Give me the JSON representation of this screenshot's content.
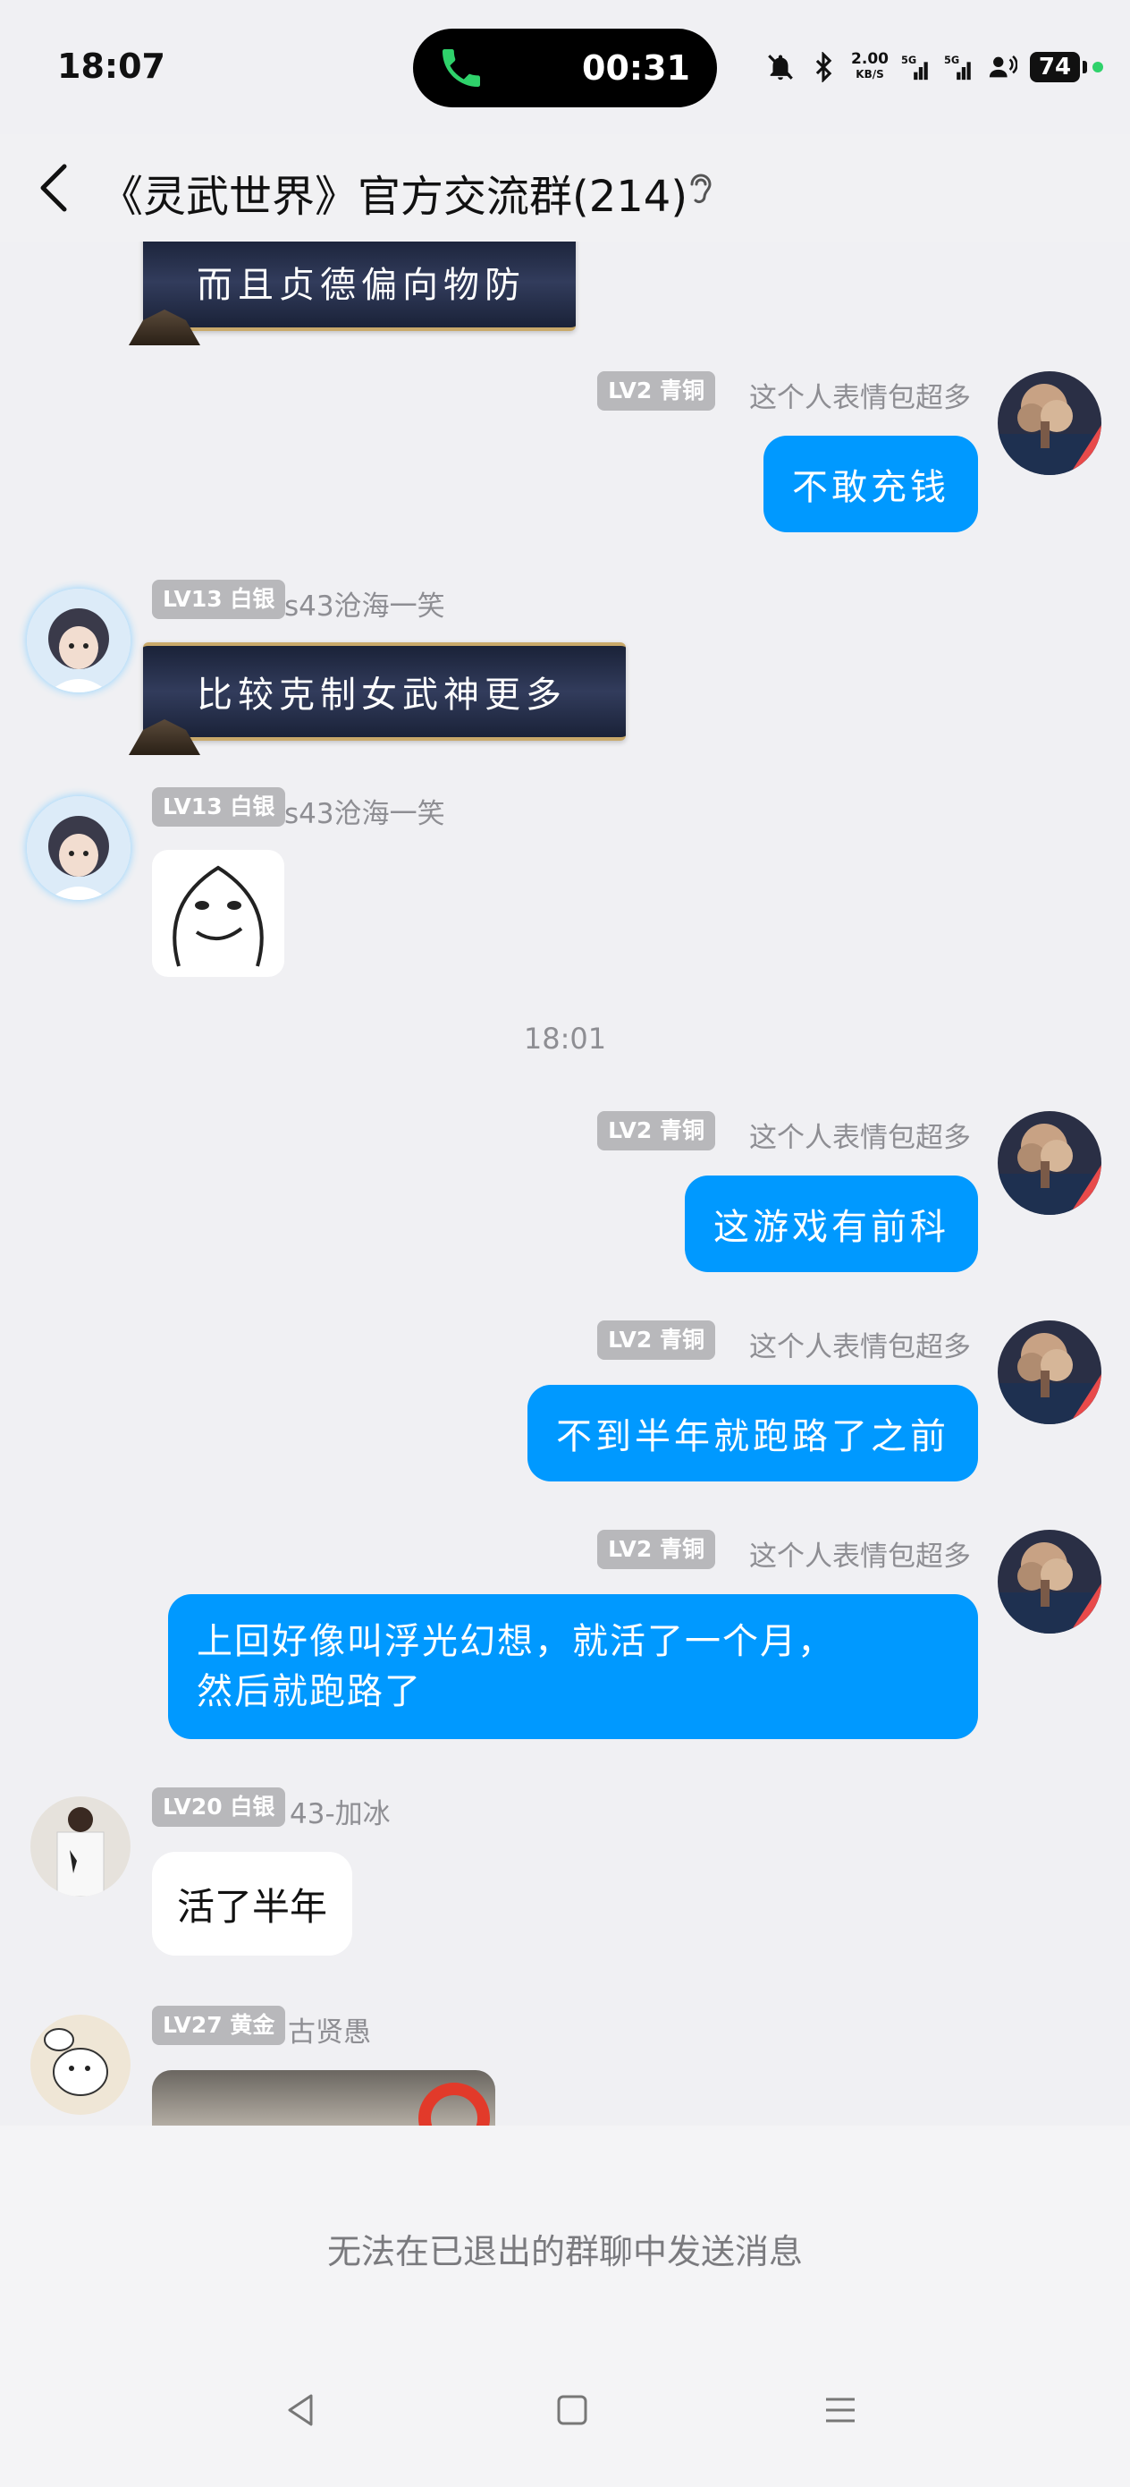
{
  "status_bar": {
    "time": "18:07",
    "call_duration": "00:31",
    "net_speed": "2.00",
    "net_unit": "KB/S",
    "battery": "74"
  },
  "header": {
    "title": "《灵武世界》官方交流群(214)"
  },
  "messages": {
    "m0": {
      "text": "而且贞德偏向物防"
    },
    "m1": {
      "badge": "LV2 青铜",
      "nick": "这个人表情包超多",
      "text": "不敢充钱"
    },
    "m2": {
      "badge": "LV13 白银",
      "nick": "s43沧海一笑",
      "text": "比较克制女武神更多"
    },
    "m3": {
      "badge": "LV13 白银",
      "nick": "s43沧海一笑"
    },
    "time_divider": "18:01",
    "m4": {
      "badge": "LV2 青铜",
      "nick": "这个人表情包超多",
      "text": "这游戏有前科"
    },
    "m5": {
      "badge": "LV2 青铜",
      "nick": "这个人表情包超多",
      "text": "不到半年就跑路了之前"
    },
    "m6": {
      "badge": "LV2 青铜",
      "nick": "这个人表情包超多",
      "line1": "上回好像叫浮光幻想，就活了一个月，",
      "line2": "然后就跑路了"
    },
    "m7": {
      "badge": "LV20 白银",
      "nick": "43-加冰",
      "text": "活了半年"
    },
    "m8": {
      "badge": "LV27 黄金",
      "nick": "古贤愚"
    }
  },
  "bottom": {
    "disabled_notice": "无法在已退出的群聊中发送消息"
  },
  "colors": {
    "bubble_blue": "#0099ff",
    "background": "#f0f0f3",
    "badge_gray": "#b8b8bb"
  }
}
